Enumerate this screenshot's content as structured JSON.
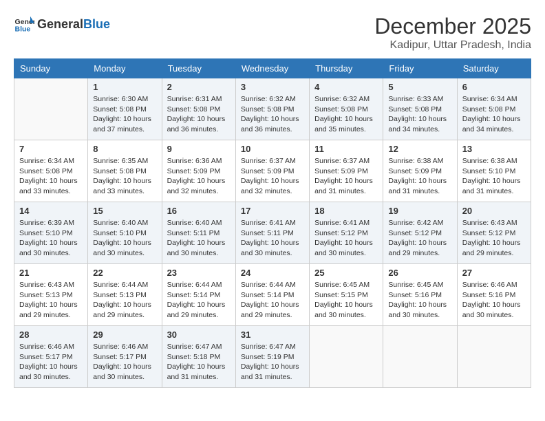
{
  "header": {
    "logo_general": "General",
    "logo_blue": "Blue",
    "month": "December 2025",
    "location": "Kadipur, Uttar Pradesh, India"
  },
  "weekdays": [
    "Sunday",
    "Monday",
    "Tuesday",
    "Wednesday",
    "Thursday",
    "Friday",
    "Saturday"
  ],
  "weeks": [
    [
      {
        "day": "",
        "info": ""
      },
      {
        "day": "1",
        "info": "Sunrise: 6:30 AM\nSunset: 5:08 PM\nDaylight: 10 hours\nand 37 minutes."
      },
      {
        "day": "2",
        "info": "Sunrise: 6:31 AM\nSunset: 5:08 PM\nDaylight: 10 hours\nand 36 minutes."
      },
      {
        "day": "3",
        "info": "Sunrise: 6:32 AM\nSunset: 5:08 PM\nDaylight: 10 hours\nand 36 minutes."
      },
      {
        "day": "4",
        "info": "Sunrise: 6:32 AM\nSunset: 5:08 PM\nDaylight: 10 hours\nand 35 minutes."
      },
      {
        "day": "5",
        "info": "Sunrise: 6:33 AM\nSunset: 5:08 PM\nDaylight: 10 hours\nand 34 minutes."
      },
      {
        "day": "6",
        "info": "Sunrise: 6:34 AM\nSunset: 5:08 PM\nDaylight: 10 hours\nand 34 minutes."
      }
    ],
    [
      {
        "day": "7",
        "info": "Sunrise: 6:34 AM\nSunset: 5:08 PM\nDaylight: 10 hours\nand 33 minutes."
      },
      {
        "day": "8",
        "info": "Sunrise: 6:35 AM\nSunset: 5:08 PM\nDaylight: 10 hours\nand 33 minutes."
      },
      {
        "day": "9",
        "info": "Sunrise: 6:36 AM\nSunset: 5:09 PM\nDaylight: 10 hours\nand 32 minutes."
      },
      {
        "day": "10",
        "info": "Sunrise: 6:37 AM\nSunset: 5:09 PM\nDaylight: 10 hours\nand 32 minutes."
      },
      {
        "day": "11",
        "info": "Sunrise: 6:37 AM\nSunset: 5:09 PM\nDaylight: 10 hours\nand 31 minutes."
      },
      {
        "day": "12",
        "info": "Sunrise: 6:38 AM\nSunset: 5:09 PM\nDaylight: 10 hours\nand 31 minutes."
      },
      {
        "day": "13",
        "info": "Sunrise: 6:38 AM\nSunset: 5:10 PM\nDaylight: 10 hours\nand 31 minutes."
      }
    ],
    [
      {
        "day": "14",
        "info": "Sunrise: 6:39 AM\nSunset: 5:10 PM\nDaylight: 10 hours\nand 30 minutes."
      },
      {
        "day": "15",
        "info": "Sunrise: 6:40 AM\nSunset: 5:10 PM\nDaylight: 10 hours\nand 30 minutes."
      },
      {
        "day": "16",
        "info": "Sunrise: 6:40 AM\nSunset: 5:11 PM\nDaylight: 10 hours\nand 30 minutes."
      },
      {
        "day": "17",
        "info": "Sunrise: 6:41 AM\nSunset: 5:11 PM\nDaylight: 10 hours\nand 30 minutes."
      },
      {
        "day": "18",
        "info": "Sunrise: 6:41 AM\nSunset: 5:12 PM\nDaylight: 10 hours\nand 30 minutes."
      },
      {
        "day": "19",
        "info": "Sunrise: 6:42 AM\nSunset: 5:12 PM\nDaylight: 10 hours\nand 29 minutes."
      },
      {
        "day": "20",
        "info": "Sunrise: 6:43 AM\nSunset: 5:12 PM\nDaylight: 10 hours\nand 29 minutes."
      }
    ],
    [
      {
        "day": "21",
        "info": "Sunrise: 6:43 AM\nSunset: 5:13 PM\nDaylight: 10 hours\nand 29 minutes."
      },
      {
        "day": "22",
        "info": "Sunrise: 6:44 AM\nSunset: 5:13 PM\nDaylight: 10 hours\nand 29 minutes."
      },
      {
        "day": "23",
        "info": "Sunrise: 6:44 AM\nSunset: 5:14 PM\nDaylight: 10 hours\nand 29 minutes."
      },
      {
        "day": "24",
        "info": "Sunrise: 6:44 AM\nSunset: 5:14 PM\nDaylight: 10 hours\nand 29 minutes."
      },
      {
        "day": "25",
        "info": "Sunrise: 6:45 AM\nSunset: 5:15 PM\nDaylight: 10 hours\nand 30 minutes."
      },
      {
        "day": "26",
        "info": "Sunrise: 6:45 AM\nSunset: 5:16 PM\nDaylight: 10 hours\nand 30 minutes."
      },
      {
        "day": "27",
        "info": "Sunrise: 6:46 AM\nSunset: 5:16 PM\nDaylight: 10 hours\nand 30 minutes."
      }
    ],
    [
      {
        "day": "28",
        "info": "Sunrise: 6:46 AM\nSunset: 5:17 PM\nDaylight: 10 hours\nand 30 minutes."
      },
      {
        "day": "29",
        "info": "Sunrise: 6:46 AM\nSunset: 5:17 PM\nDaylight: 10 hours\nand 30 minutes."
      },
      {
        "day": "30",
        "info": "Sunrise: 6:47 AM\nSunset: 5:18 PM\nDaylight: 10 hours\nand 31 minutes."
      },
      {
        "day": "31",
        "info": "Sunrise: 6:47 AM\nSunset: 5:19 PM\nDaylight: 10 hours\nand 31 minutes."
      },
      {
        "day": "",
        "info": ""
      },
      {
        "day": "",
        "info": ""
      },
      {
        "day": "",
        "info": ""
      }
    ]
  ]
}
